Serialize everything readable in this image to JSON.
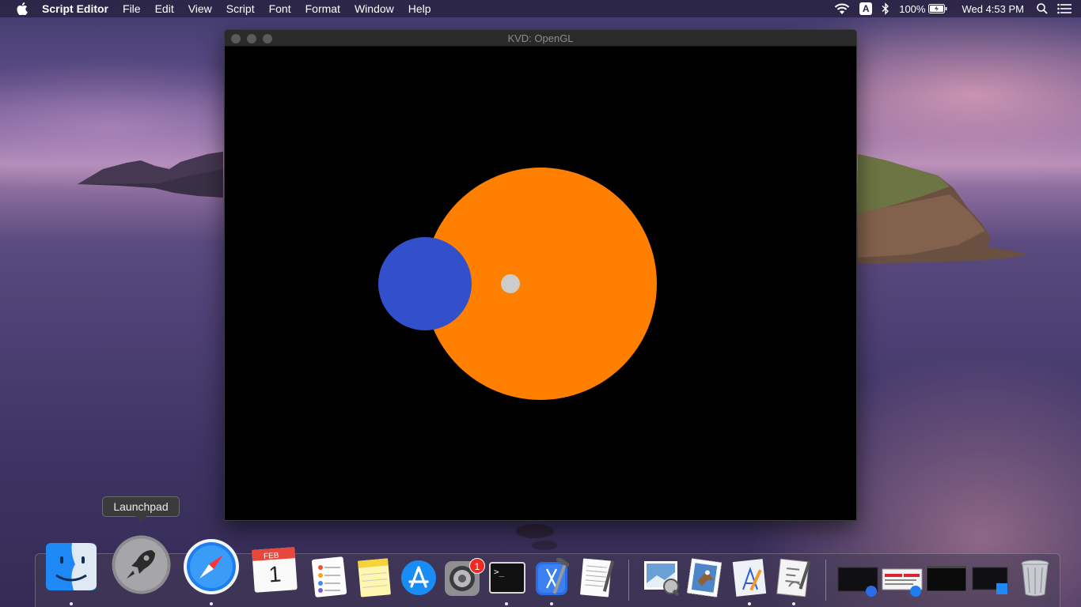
{
  "menubar": {
    "app_name": "Script Editor",
    "items": [
      "File",
      "Edit",
      "View",
      "Script",
      "Font",
      "Format",
      "Window",
      "Help"
    ],
    "status": {
      "input_source": "A",
      "battery": "100%",
      "clock": "Wed 4:53 PM"
    }
  },
  "window": {
    "title": "KVD: OpenGL",
    "canvas": {
      "background": "#000000",
      "colors": {
        "large_circle": "#ff8000",
        "medium_circle": "#3350cc",
        "small_circle": "#cccccc"
      }
    }
  },
  "dock": {
    "tooltip": "Launchpad",
    "calendar": {
      "month": "FEB",
      "day": "1"
    },
    "terminal_prompt": ">_",
    "system_preferences_badge": "1",
    "apps": [
      "Finder",
      "Launchpad",
      "Safari",
      "Calendar",
      "Reminders",
      "Notes",
      "App Store",
      "System Preferences",
      "Terminal",
      "Xcode",
      "TextEdit",
      "Preview",
      "Mail",
      "Instruments",
      "Script Editor",
      "Trash"
    ]
  }
}
